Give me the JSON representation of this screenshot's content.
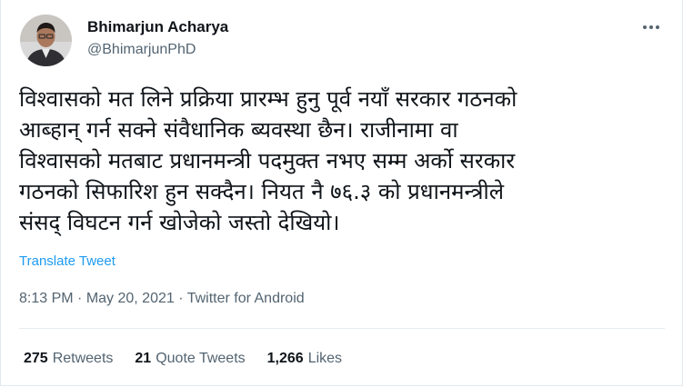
{
  "author": {
    "name": "Bhimarjun Acharya",
    "handle": "@BhimarjunPhD"
  },
  "tweet": {
    "text": "विश्वासको मत लिने प्रक्रिया प्रारम्भ हुनु पूर्व नयाँ सरकार गठनको\nआब्हान् गर्न सक्ने संवैधानिक ब्यवस्था छैन। राजीनामा वा\nविश्वासको मतबाट प्रधानमन्त्री पदमुक्त नभए सम्म अर्को सरकार\nगठनको सिफारिश हुन सक्दैन। नियत नै ७६.३ को प्रधानमन्त्रीले\nसंसद् विघटन गर्न खोजेको जस्तो देखियो।",
    "translate_label": "Translate Tweet",
    "time": "8:13 PM",
    "separator": " · ",
    "date": "May 20, 2021",
    "source": "Twitter for Android"
  },
  "stats": {
    "retweets_count": "275",
    "retweets_label": "Retweets",
    "quotes_count": "21",
    "quotes_label": "Quote Tweets",
    "likes_count": "1,266",
    "likes_label": "Likes"
  },
  "icons": {
    "more": "more-options-icon"
  },
  "colors": {
    "link": "#1d9bf0",
    "secondary_text": "#536471",
    "primary_text": "#0f1419",
    "divider": "#e6ecf0"
  }
}
